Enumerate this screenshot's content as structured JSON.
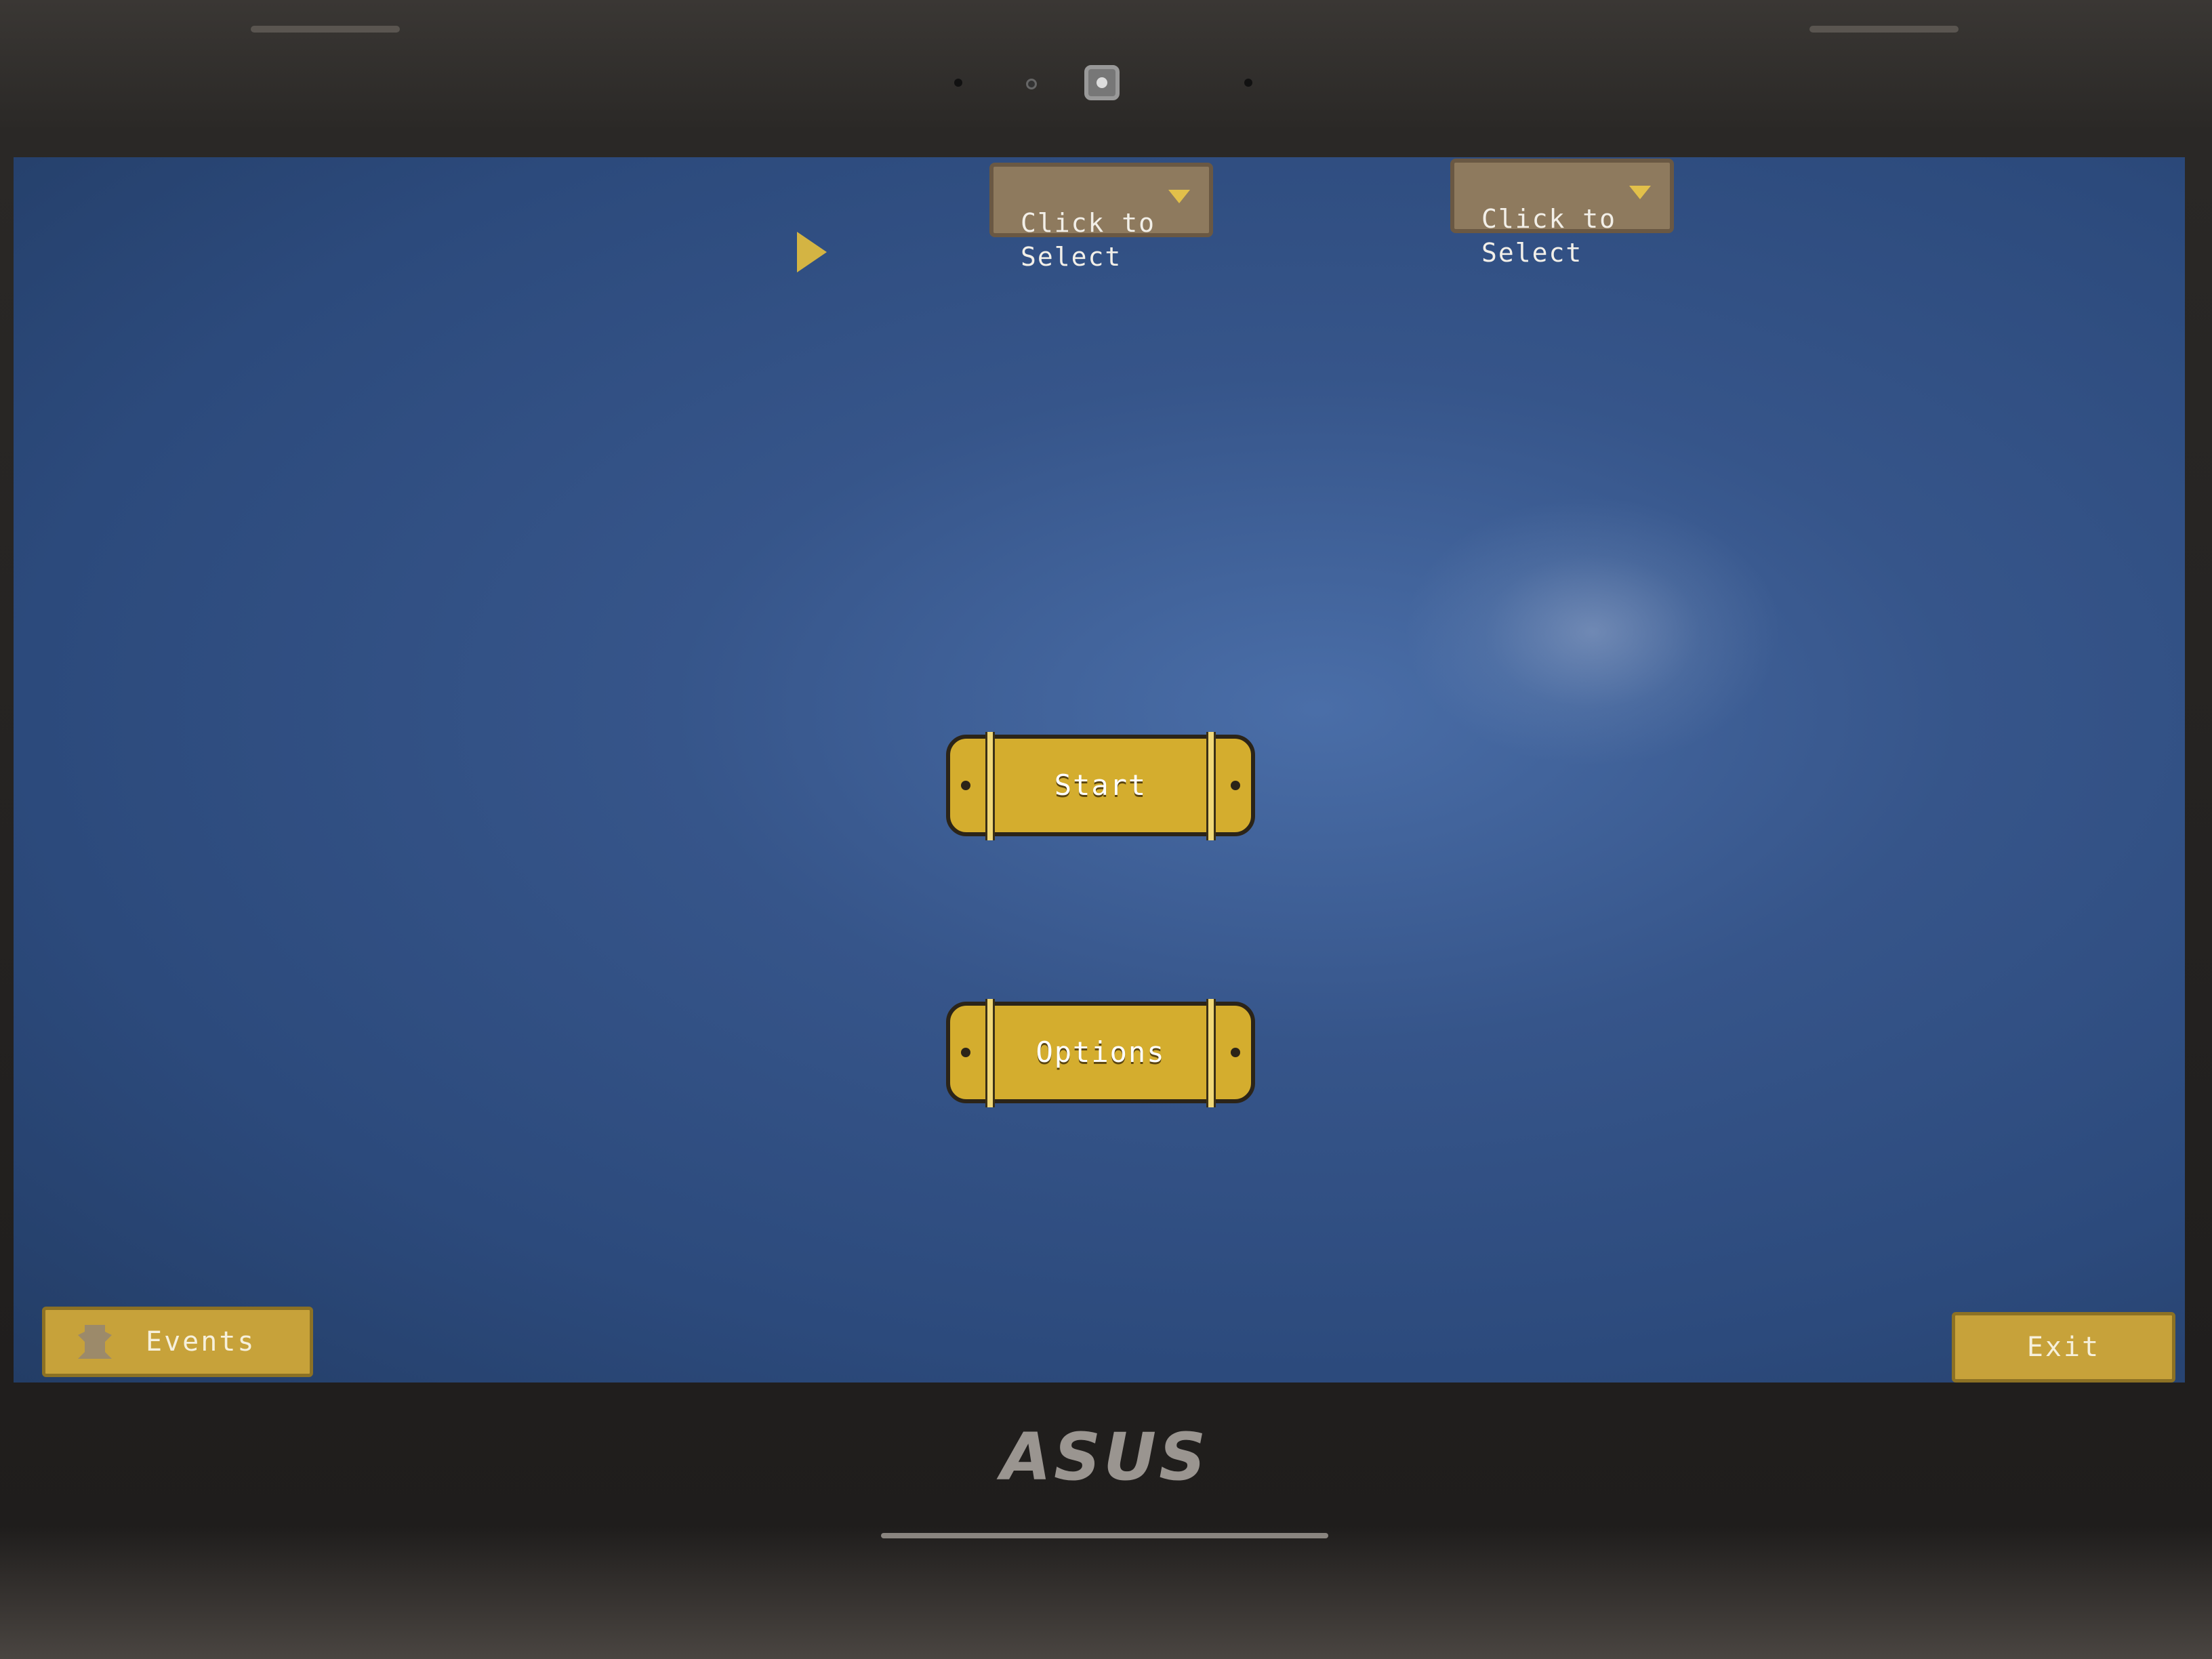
{
  "device": {
    "brand_logo": "ASUS"
  },
  "screen": {
    "background_color": "#2f4f83"
  },
  "dropdowns": [
    {
      "label": "Click to\nSelect",
      "icon": "chevron-down-icon"
    },
    {
      "label": "Click to\nSelect",
      "icon": "chevron-down-icon"
    }
  ],
  "main_menu": {
    "start_label": "Start",
    "options_label": "Options"
  },
  "footer": {
    "events_label": "Events",
    "events_icon": "bear-icon",
    "exit_label": "Exit"
  },
  "colors": {
    "button_gold": "#d4ad2e",
    "dropdown_brown": "#8e7a5e"
  }
}
